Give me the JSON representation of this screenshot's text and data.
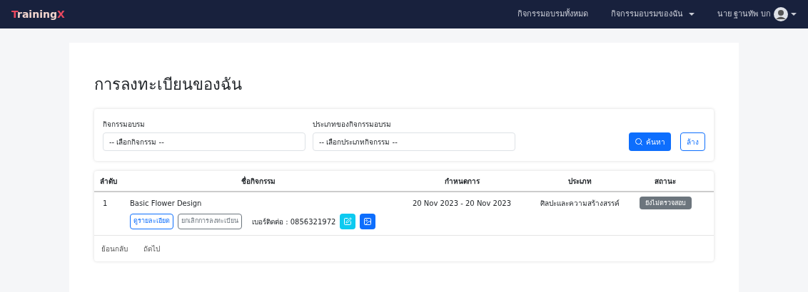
{
  "navbar": {
    "brand": [
      {
        "text": "T",
        "color": "#e8485f"
      },
      {
        "text": "raining",
        "color": "#f4d7d0"
      },
      {
        "text": "X",
        "color": "#e8485f"
      }
    ],
    "links": [
      {
        "label": "กิจกรรมอบรมทั้งหมด",
        "dropdown": false
      },
      {
        "label": "กิจกรรมอบรมของฉัน",
        "dropdown": true
      }
    ],
    "user": {
      "label": "นาย ฐานทัพ บก"
    }
  },
  "page_title": "การลงทะเบียนของฉัน",
  "filters": {
    "fields": [
      {
        "label": "กิจกรรมอบรม",
        "value": "-- เลือกกิจกรรม --"
      },
      {
        "label": "ประเภทของกิจกรรมอบรม",
        "value": "-- เลือกประเภทกิจกรรม --"
      }
    ],
    "search_button": "ค้นหา",
    "clear_button": "ล้าง"
  },
  "table": {
    "columns": [
      "ลำดับ",
      "ชื่อกิจกรรม",
      "กำหนดการ",
      "ประเภท",
      "สถานะ"
    ],
    "rows": [
      {
        "index": "1",
        "name": "Basic Flower Design",
        "schedule": "20 Nov 2023 - 20 Nov 2023",
        "type": "ศิลปะและความสร้างสรรค์",
        "status": "ยังไม่ตรวจสอบ",
        "details_button": "ดูรายละเอียด",
        "cancel_button": "ยกเลิกการลงทะเบียน",
        "contact": "เบอร์ติดต่อ : 0856321972"
      }
    ]
  },
  "pagination": [
    "ย้อนกลับ",
    "ถัดไป"
  ]
}
